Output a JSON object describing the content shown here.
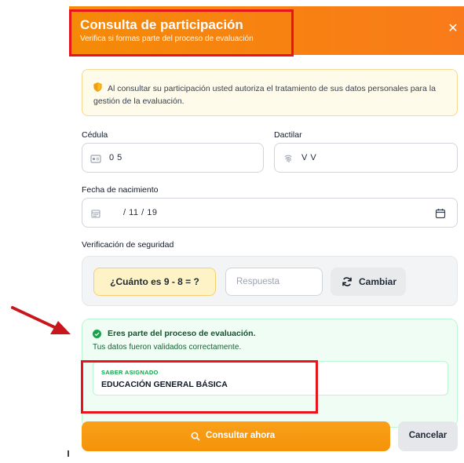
{
  "modal": {
    "title": "Consulta de participación",
    "subtitle": "Verifica si formas parte del proceso de evaluación",
    "close_icon": "close-icon",
    "accent_color": "#f58a07"
  },
  "notice": {
    "icon": "shield-icon",
    "text": "Al consultar su participación usted autoriza el tratamiento de sus datos personales para la gestión de la evaluación."
  },
  "form": {
    "cedula": {
      "label": "Cédula",
      "icon": "id-card-icon",
      "value": "0            5"
    },
    "dactilar": {
      "label": "Dactilar",
      "icon": "fingerprint-icon",
      "value": "V       V"
    },
    "fecha": {
      "label": "Fecha de nacimiento",
      "icon": "calendar-icon",
      "value": "/ 11 / 19",
      "picker_icon": "calendar-picker-icon"
    },
    "security": {
      "label": "Verificación de seguridad",
      "question": "¿Cuánto es 9 - 8 = ?",
      "answer_placeholder": "Respuesta",
      "change_label": "Cambiar",
      "change_icon": "refresh-icon"
    }
  },
  "result": {
    "icon": "check-circle-icon",
    "title": "Eres parte del proceso de evaluación.",
    "subtitle": "Tus datos fueron validados correctamente.",
    "assigned_label": "SABER ASIGNADO",
    "assigned_value": "EDUCACIÓN GENERAL BÁSICA",
    "color": "#16a34a"
  },
  "actions": {
    "primary_label": "Consultar ahora",
    "primary_icon": "search-icon",
    "secondary_label": "Cancelar"
  },
  "annotations": {
    "highlight_color": "#e8141c",
    "arrow_icon": "red-arrow-icon"
  }
}
